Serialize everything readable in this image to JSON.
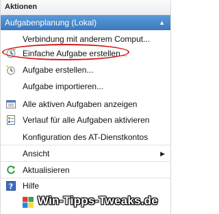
{
  "panel": {
    "title": "Aktionen",
    "group": {
      "label": "Aufgabenplanung (Lokal)",
      "collapse_icon": "triangle-up-icon"
    }
  },
  "items": [
    {
      "label": "Verbindung mit anderem Comput...",
      "icon": "none"
    },
    {
      "label": "Einfache Aufgabe erstellen...",
      "icon": "task-wizard-icon"
    },
    {
      "label": "Aufgabe erstellen...",
      "icon": "new-task-icon"
    },
    {
      "label": "Aufgabe importieren...",
      "icon": "none"
    },
    {
      "label": "Alle aktiven Aufgaben anzeigen",
      "icon": "task-list-icon"
    },
    {
      "label": "Verlauf für alle Aufgaben aktivieren",
      "icon": "history-icon"
    },
    {
      "label": "Konfiguration des AT-Dienstkontos",
      "icon": "none"
    },
    {
      "label": "Ansicht",
      "icon": "none",
      "submenu_icon": "triangle-right-icon"
    },
    {
      "label": "Aktualisieren",
      "icon": "refresh-icon"
    },
    {
      "label": "Hilfe",
      "icon": "help-icon"
    }
  ],
  "annotation": {
    "color": "#d21a1a",
    "highlighted_item": "Einfache Aufgabe erstellen..."
  },
  "watermark": {
    "text": "Win-Tipps-Tweaks.de",
    "logo_colors": [
      "#e53935",
      "#43a047",
      "#1e88e5",
      "#fdd835"
    ]
  },
  "colors": {
    "group_bar": "#4a89ca",
    "group_text": "#ffffff"
  }
}
